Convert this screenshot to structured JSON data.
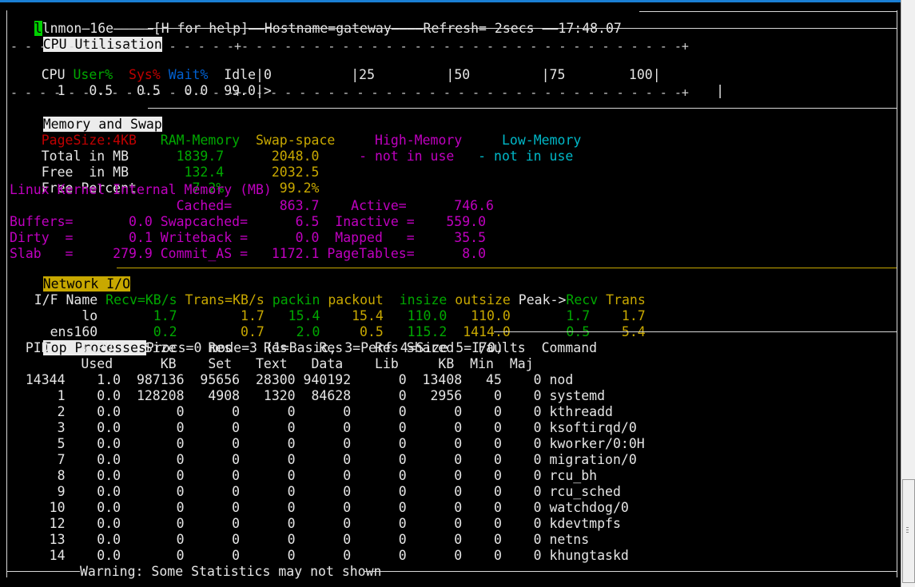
{
  "app": {
    "title_line": "lnmon—16e—————[H for help]——Hostname=gateway————Refresh= 2secs ——17:48.07",
    "name": "lnmon",
    "version": "16e",
    "help_hint": "[H for help]",
    "hostname_label": "Hostname=gateway",
    "refresh_label": "Refresh= 2secs",
    "clock": "17:48.07",
    "cursor_char": "l"
  },
  "cpu": {
    "section_title": "CPU Utilisation",
    "headers": [
      "CPU",
      "User%",
      "Sys%",
      "Wait%",
      "Idle"
    ],
    "scale_labels": [
      "0",
      "|25",
      "|50",
      "|75",
      "100|"
    ],
    "rows": [
      {
        "cpu": "1",
        "user": "0.5",
        "sys": "0.5",
        "wait": "0.0",
        "idle": "99.0",
        "bar": ">"
      }
    ],
    "colors": {
      "user": "#00a800",
      "sys": "#c00000",
      "wait": "#0060d0",
      "idle": "#e6e6e6"
    }
  },
  "memory": {
    "section_title": "Memory and Swap",
    "page_size": "PageSize:4KB",
    "col_headers": [
      "RAM-Memory",
      "Swap-space",
      "High-Memory",
      "Low-Memory"
    ],
    "rows": [
      {
        "label": "Total in MB",
        "ram": "1839.7",
        "swap": "2048.0",
        "high": "- not in use",
        "low": "- not in use"
      },
      {
        "label": "Free  in MB",
        "ram": "132.4",
        "swap": "2032.5",
        "high": "",
        "low": ""
      },
      {
        "label": "Free Percent",
        "ram": "7.2%",
        "swap": "99.2%",
        "high": "",
        "low": ""
      }
    ],
    "kernel_title": "Linux Kernel Internal Memory (MB)",
    "kernel_rows": [
      {
        "c1k": "",
        "c1v": "",
        "c2k": "Cached=",
        "c2v": "863.7",
        "c3k": "Active=",
        "c3v": "746.6"
      },
      {
        "c1k": "Buffers=",
        "c1v": "0.0",
        "c2k": "Swapcached=",
        "c2v": "6.5",
        "c3k": "Inactive =",
        "c3v": "559.0"
      },
      {
        "c1k": "Dirty  =",
        "c1v": "0.1",
        "c2k": "Writeback =",
        "c2v": "0.0",
        "c3k": "Mapped   =",
        "c3v": "35.5"
      },
      {
        "c1k": "Slab   =",
        "c1v": "279.9",
        "c2k": "Commit_AS =",
        "c2v": "1172.1",
        "c3k": "PageTables=",
        "c3v": "8.0"
      }
    ],
    "colors": {
      "page_size": "#c00000",
      "ram": "#00a800",
      "swap": "#c8a800",
      "high": "#c000c0",
      "low": "#00b8c8",
      "kernel": "#c000c0"
    }
  },
  "network": {
    "section_title": "Network I/O",
    "headers": [
      "I/F Name",
      "Recv=KB/s",
      "Trans=KB/s",
      "packin",
      "packout",
      "insize",
      "outsize",
      "Peak->Recv",
      "Trans"
    ],
    "rows": [
      {
        "iface": "lo",
        "recv": "1.7",
        "trans": "1.7",
        "packin": "15.4",
        "packout": "15.4",
        "insize": "110.0",
        "outsize": "110.0",
        "peak_recv": "1.7",
        "peak_trans": "1.7"
      },
      {
        "iface": "ens160",
        "recv": "0.2",
        "trans": "0.7",
        "packin": "2.0",
        "packout": "0.5",
        "insize": "115.2",
        "outsize": "1414.0",
        "peak_recv": "0.5",
        "peak_trans": "5.4"
      }
    ],
    "colors": {
      "recv": "#00a800",
      "trans": "#c8a800",
      "label_bg": "#c8a800"
    }
  },
  "processes": {
    "section_title": "Top Processes",
    "mode_line": "Procs=0 mode=3 (1=Basic, 3=Perf 4=Size 5=I/O)",
    "header_line1": [
      "PID",
      "%CPU",
      "Size",
      "Res",
      "Res",
      "Res",
      "Res",
      "Shared",
      "Faults",
      "Command"
    ],
    "header_line2": [
      "",
      "Used",
      "KB",
      "Set",
      "Text",
      "Data",
      "Lib",
      "KB",
      "Min",
      "Maj",
      ""
    ],
    "rows": [
      {
        "pid": "14344",
        "cpu": "1.0",
        "size": "987136",
        "res_set": "95656",
        "res_text": "28300",
        "res_data": "940192",
        "res_lib": "0",
        "shared": "13408",
        "min": "45",
        "maj": "0",
        "command": "nod"
      },
      {
        "pid": "1",
        "cpu": "0.0",
        "size": "128208",
        "res_set": "4908",
        "res_text": "1320",
        "res_data": "84628",
        "res_lib": "0",
        "shared": "2956",
        "min": "0",
        "maj": "0",
        "command": "systemd"
      },
      {
        "pid": "2",
        "cpu": "0.0",
        "size": "0",
        "res_set": "0",
        "res_text": "0",
        "res_data": "0",
        "res_lib": "0",
        "shared": "0",
        "min": "0",
        "maj": "0",
        "command": "kthreadd"
      },
      {
        "pid": "3",
        "cpu": "0.0",
        "size": "0",
        "res_set": "0",
        "res_text": "0",
        "res_data": "0",
        "res_lib": "0",
        "shared": "0",
        "min": "0",
        "maj": "0",
        "command": "ksoftirqd/0"
      },
      {
        "pid": "5",
        "cpu": "0.0",
        "size": "0",
        "res_set": "0",
        "res_text": "0",
        "res_data": "0",
        "res_lib": "0",
        "shared": "0",
        "min": "0",
        "maj": "0",
        "command": "kworker/0:0H"
      },
      {
        "pid": "7",
        "cpu": "0.0",
        "size": "0",
        "res_set": "0",
        "res_text": "0",
        "res_data": "0",
        "res_lib": "0",
        "shared": "0",
        "min": "0",
        "maj": "0",
        "command": "migration/0"
      },
      {
        "pid": "8",
        "cpu": "0.0",
        "size": "0",
        "res_set": "0",
        "res_text": "0",
        "res_data": "0",
        "res_lib": "0",
        "shared": "0",
        "min": "0",
        "maj": "0",
        "command": "rcu_bh"
      },
      {
        "pid": "9",
        "cpu": "0.0",
        "size": "0",
        "res_set": "0",
        "res_text": "0",
        "res_data": "0",
        "res_lib": "0",
        "shared": "0",
        "min": "0",
        "maj": "0",
        "command": "rcu_sched"
      },
      {
        "pid": "10",
        "cpu": "0.0",
        "size": "0",
        "res_set": "0",
        "res_text": "0",
        "res_data": "0",
        "res_lib": "0",
        "shared": "0",
        "min": "0",
        "maj": "0",
        "command": "watchdog/0"
      },
      {
        "pid": "12",
        "cpu": "0.0",
        "size": "0",
        "res_set": "0",
        "res_text": "0",
        "res_data": "0",
        "res_lib": "0",
        "shared": "0",
        "min": "0",
        "maj": "0",
        "command": "kdevtmpfs"
      },
      {
        "pid": "13",
        "cpu": "0.0",
        "size": "0",
        "res_set": "0",
        "res_text": "0",
        "res_data": "0",
        "res_lib": "0",
        "shared": "0",
        "min": "0",
        "maj": "0",
        "command": "netns"
      },
      {
        "pid": "14",
        "cpu": "0.0",
        "size": "0",
        "res_set": "0",
        "res_text": "0",
        "res_data": "0",
        "res_lib": "0",
        "shared": "0",
        "min": "0",
        "maj": "0",
        "command": "khungtaskd"
      }
    ]
  },
  "footer": {
    "warning": "Warning: Some Statistics may not shown"
  },
  "lines": {
    "title_dashes": "—————",
    "cpu_sep_top": "- - - - - - - - - - - - - - - -+- - - - - - - - - - - - - - - - - - - - - - - - - - - - - - -+",
    "cpu_sep_bottom": "- - - - - - - - - - - - - - - -+- - - - - - - - - - - - - - - - - - - - - - - - - - - - - - -+"
  },
  "rendered_text": {
    "cpu_header": "CPU User%  Sys% Wait%  Idle|0          |25         |50         |75        100|",
    "cpu_row1": "  1   0.5   0.5   0.0  99.0|>                                                        |",
    "mem_hdr": "PageSize:4KB   RAM-Memory  Swap-space     High-Memory     Low-Memory",
    "mem_total": "Total in MB        1839.7      2048.0     - not in use   - not in use",
    "mem_free": "Free  in MB         132.4      2032.5",
    "mem_pct": "Free Percent         7.2%       99.2%",
    "kernel_hdr": "Linux Kernel Internal Memory (MB)",
    "kernel_r1": "                     Cached=      863.7    Active=      746.6",
    "kernel_r2": "Buffers=       0.0 Swapcached=      6.5  Inactive =    559.0",
    "kernel_r3": "Dirty  =       0.1 Writeback =      0.0  Mapped   =     35.5",
    "kernel_r4": "Slab   =     279.9 Commit_AS =   1172.1 PageTables=      8.0",
    "net_hdr": "I/F Name Recv=KB/s Trans=KB/s packin packout  insize outsize Peak->Recv Trans",
    "net_lo": "      lo       1.7        1.7   15.4    15.4   110.0   110.0       1.7    1.7",
    "net_ens": "  ens160       0.2        0.7    2.0     0.5   115.2  1414.0       0.5    5.4",
    "proc_hdr1": "  PID    %CPU    Size    Res    Res    Res    Res Shared   Faults  Command",
    "proc_hdr2": "         Used      KB    Set   Text   Data    Lib     KB  Min  Maj"
  }
}
